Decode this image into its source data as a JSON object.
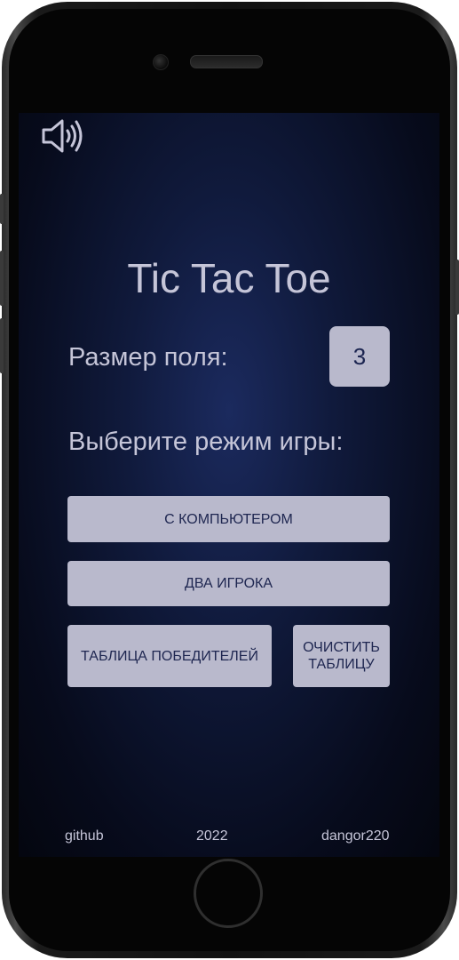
{
  "app": {
    "title": "Tic Tac Toe"
  },
  "sound": {
    "icon": "speaker-on-icon",
    "color": "#c5c5d8"
  },
  "settings": {
    "size_label": "Размер поля:",
    "size_value": "3",
    "mode_label": "Выберите режим игры:"
  },
  "buttons": {
    "vs_computer": "С КОМПЬЮТЕРОМ",
    "two_players": "ДВА ИГРОКА",
    "leaderboard": "ТАБЛИЦА ПОБЕДИТЕЛЕЙ",
    "clear_table": "ОЧИСТИТЬ ТАБЛИЦУ"
  },
  "footer": {
    "github": "github",
    "year": "2022",
    "author": "dangor220"
  },
  "colors": {
    "text": "#c5c5d8",
    "button_bg": "#b9b9cc",
    "button_text": "#1e2650",
    "background": "#101a3c"
  }
}
